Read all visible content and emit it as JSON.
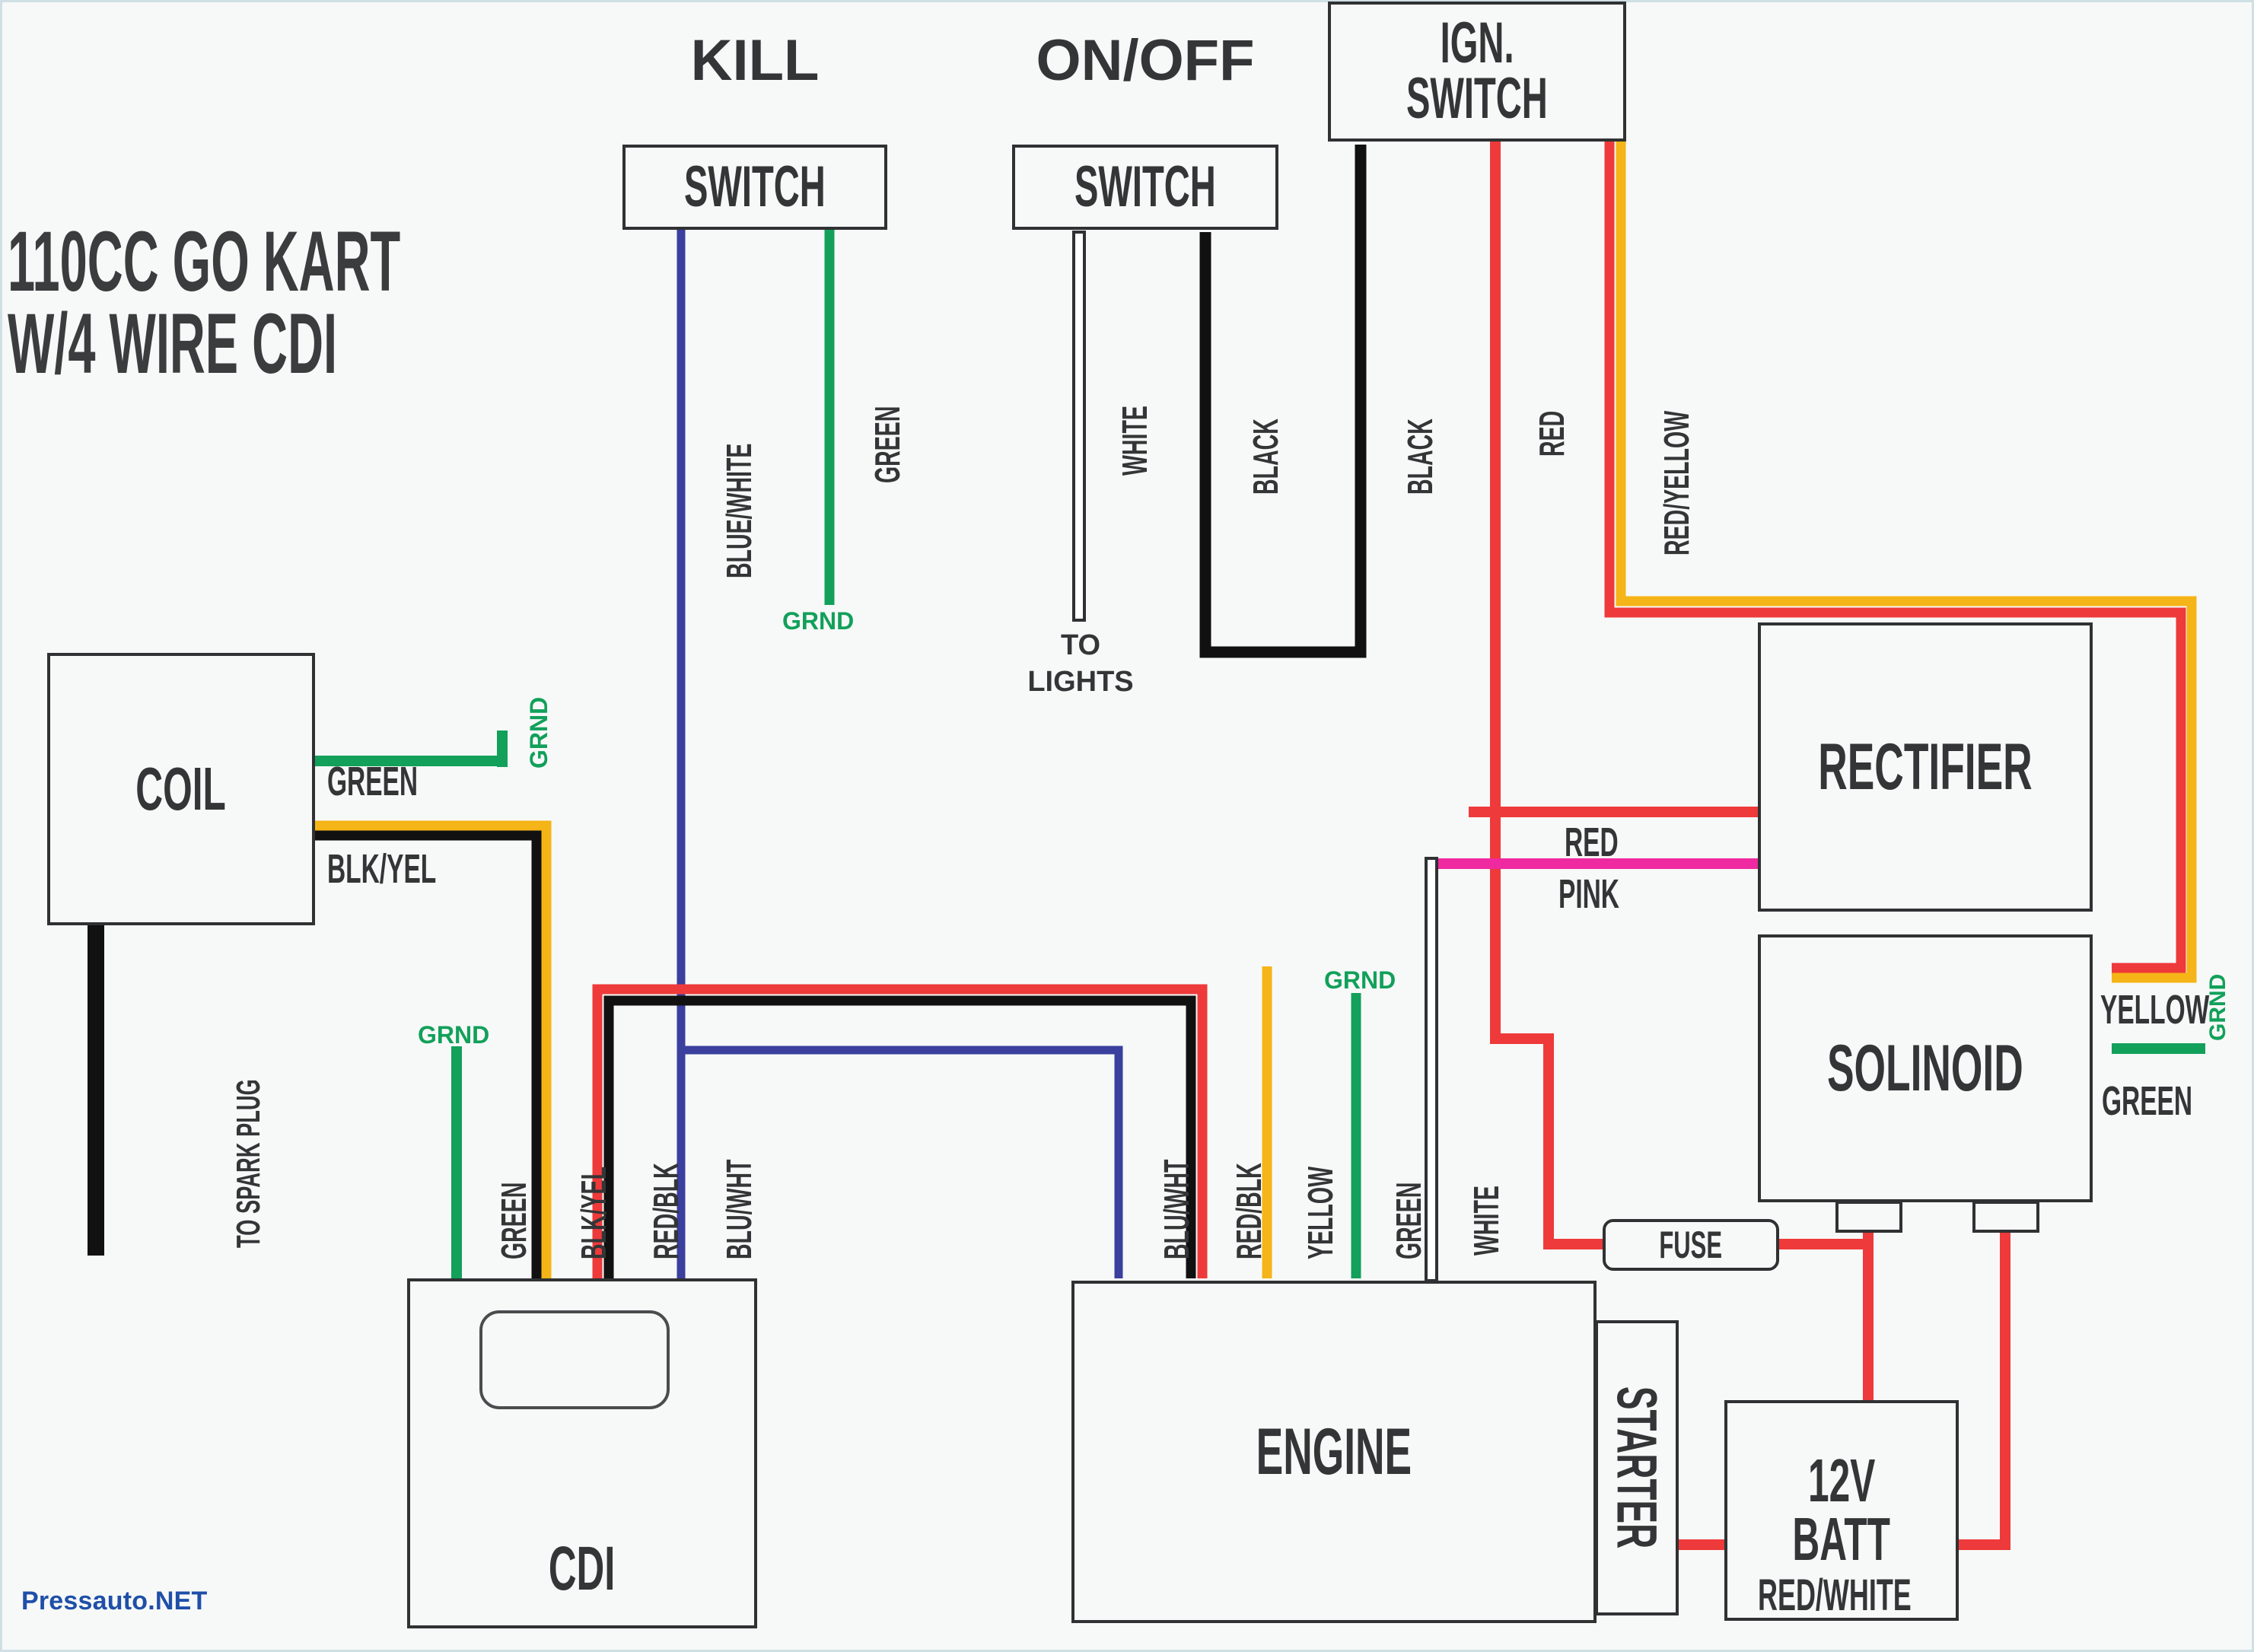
{
  "title": {
    "line1": "110CC GO KART",
    "line2": "W/4 WIRE CDI"
  },
  "watermark": "Pressauto.NET",
  "components": {
    "kill_switch": {
      "title": "KILL",
      "box_label": "SWITCH"
    },
    "onoff_switch": {
      "title": "ON/OFF",
      "box_label": "SWITCH"
    },
    "ign_switch": {
      "line1": "IGN.",
      "line2": "SWITCH"
    },
    "coil": {
      "label": "COIL"
    },
    "cdi": {
      "label": "CDI"
    },
    "engine": {
      "label": "ENGINE"
    },
    "rectifier": {
      "label": "RECTIFIER"
    },
    "solinoid": {
      "label": "SOLINOID"
    },
    "starter": {
      "label": "STARTER"
    },
    "battery": {
      "line1": "12V",
      "line2": "BATT"
    },
    "fuse": {
      "label": "FUSE"
    }
  },
  "wire_labels": {
    "kill_blue_white": "BLUE/WHITE",
    "kill_green": "GREEN",
    "kill_green_grnd": "GRND",
    "onoff_white": "WHITE",
    "onoff_to_lights_1": "TO",
    "onoff_to_lights_2": "LIGHTS",
    "onoff_black": "BLACK",
    "ign_black": "BLACK",
    "ign_red": "RED",
    "ign_red_yellow": "RED/YELLOW",
    "coil_green": "GREEN",
    "coil_green_grnd": "GRND",
    "coil_blk_yel": "BLK/YEL",
    "coil_spark": "TO SPARK PLUG",
    "cdi_grnd": "GRND",
    "cdi_green": "GREEN",
    "cdi_blk_yel": "BLK/YEL",
    "cdi_red_blk": "RED/BLK",
    "cdi_blu_wht": "BLU/WHT",
    "eng_blu_wht": "BLU/WHT",
    "eng_red_blk": "RED/BLK",
    "eng_yellow": "YELLOW",
    "eng_green": "GREEN",
    "eng_green_grnd": "GRND",
    "eng_white": "WHITE",
    "rect_red": "RED",
    "rect_pink": "PINK",
    "sol_yellow": "YELLOW",
    "sol_green": "GREEN",
    "sol_green_grnd": "GRND",
    "batt_red_white": "RED/WHITE"
  },
  "colors": {
    "red": "#ee3a3a",
    "yellow": "#f5b417",
    "green": "#12a05a",
    "blue": "#3b3f9e",
    "pink": "#ef2aa0",
    "black": "#111111",
    "white_wire": "#ffffff",
    "wire_outline": "#2f3133",
    "box_stroke": "#2f3133",
    "text": "#333537",
    "watermark": "#1f4fa8",
    "background": "#f7f9f8",
    "frame": "#cfe0e4"
  }
}
